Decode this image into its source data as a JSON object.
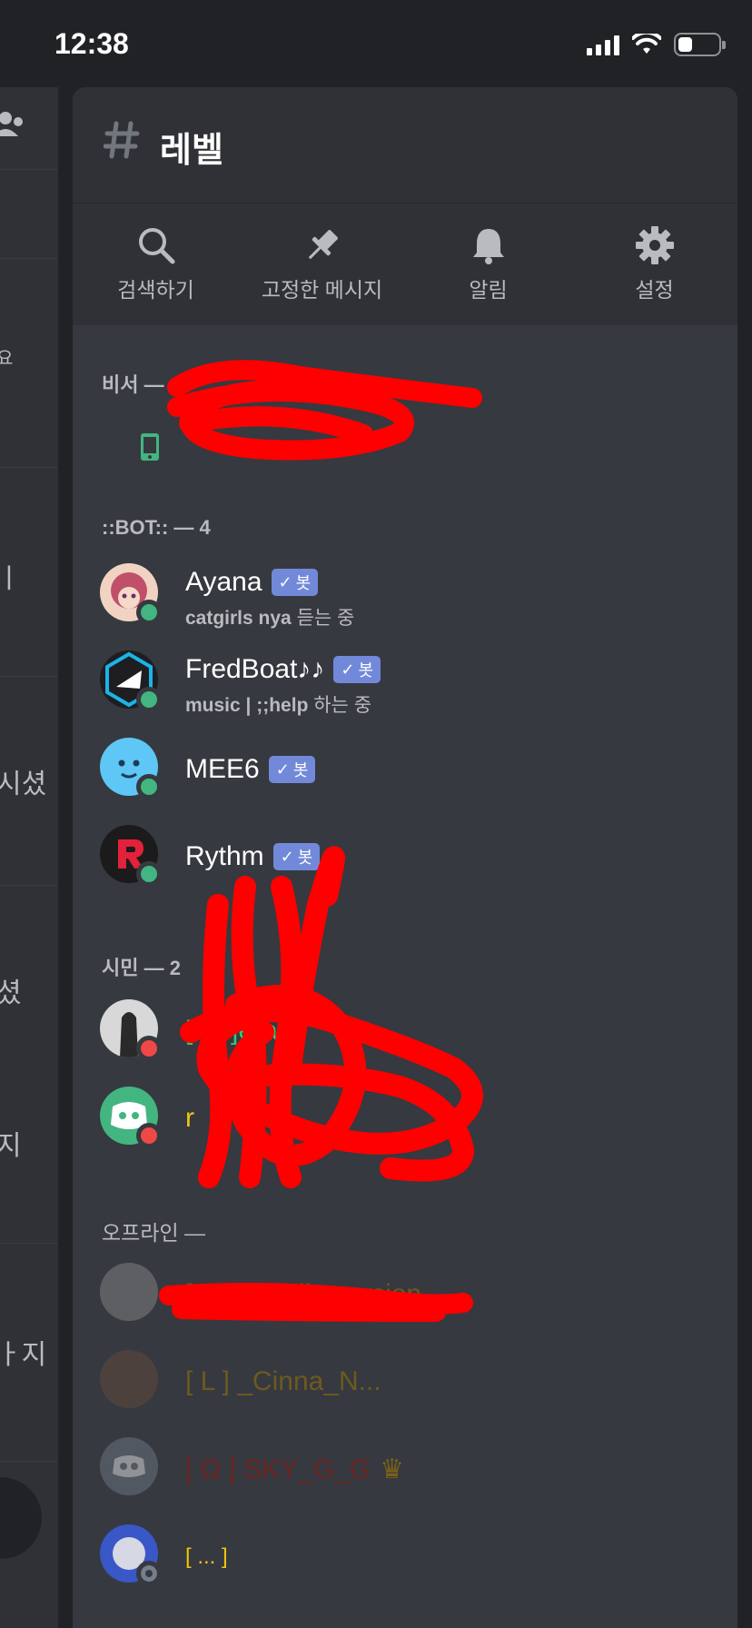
{
  "status_bar": {
    "time": "12:38",
    "battery_level": 0.35
  },
  "left_panel": {
    "fragments": [
      "요",
      "ㅣ",
      "시셨",
      "셨",
      "지",
      "ㅏ지"
    ]
  },
  "channel": {
    "name": "레벨"
  },
  "toolbar": [
    {
      "icon": "search-icon",
      "label": "검색하기"
    },
    {
      "icon": "pin-icon",
      "label": "고정한 메시지"
    },
    {
      "icon": "bell-icon",
      "label": "알림"
    },
    {
      "icon": "gear-icon",
      "label": "설정"
    }
  ],
  "sections": {
    "secretary": {
      "title": "비서 — 1"
    },
    "bot": {
      "title": "::BOT:: — 4"
    },
    "citizen": {
      "title": "시민 — 2"
    },
    "offline": {
      "title": "오프라인 — "
    }
  },
  "bots": [
    {
      "name": "Ayana",
      "tag": "봇",
      "activity_bold": "catgirls nya",
      "activity_rest": " 듣는 중",
      "avatar_color": "#c0506a",
      "status": "online"
    },
    {
      "name": "FredBoat♪♪",
      "tag": "봇",
      "activity_bold": "music | ;;help",
      "activity_rest": " 하는 중",
      "avatar_color": "#1e1e22",
      "status": "online"
    },
    {
      "name": "MEE6",
      "tag": "봇",
      "activity_bold": "",
      "activity_rest": "",
      "avatar_color": "#5ec7f5",
      "status": "online"
    },
    {
      "name": "Rythm",
      "tag": "봇",
      "activity_bold": "",
      "activity_rest": "",
      "avatar_color": "#1b1b1b",
      "status": "online"
    }
  ],
  "citizens": [
    {
      "name": "[ ... ]erard",
      "name_color": "#2ecc71",
      "avatar_color": "#d8d8d8",
      "status": "dnd"
    },
    {
      "name": "r",
      "name_color": "#f1c40f",
      "avatar_color": "#43b581",
      "status": "dnd"
    }
  ],
  "offline_members": [
    {
      "name": "[ ... ] Mobile version",
      "name_color": "#c49b1c",
      "avatar_color": "#8d8d8d"
    },
    {
      "name": "[ L ] _Cinna_N...",
      "name_color": "#c49b1c",
      "avatar_color": "#6b4b3e"
    },
    {
      "name": "[ Ω ] SKY_G_G",
      "name_color": "#b2322e",
      "avatar_color": "#747f8d",
      "crown": "♛"
    },
    {
      "name": "[ ... ]",
      "name_color": "#f1c40f",
      "avatar_color": "#3b5bd6"
    }
  ],
  "colors": {
    "online": "#43b581",
    "dnd": "#f04747",
    "offline": "#747f8d",
    "mobile": "#43b581",
    "scribble": "#ff0000"
  }
}
